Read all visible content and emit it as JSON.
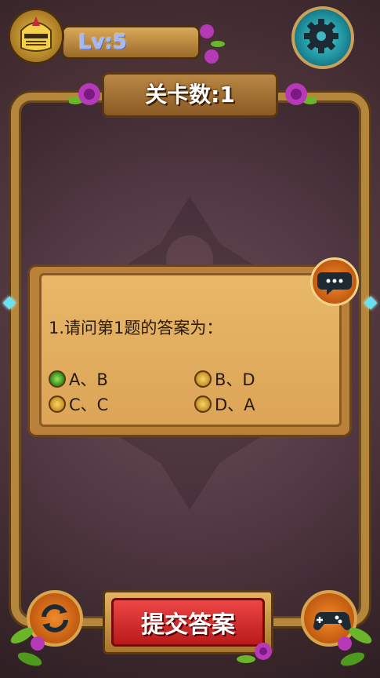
{
  "player": {
    "level_label": "Lv:5"
  },
  "header": {
    "level_title": "关卡数:1"
  },
  "question": {
    "text": "1.请问第1题的答案为：",
    "options": [
      {
        "label": "A、B",
        "selected": true
      },
      {
        "label": "B、D",
        "selected": false
      },
      {
        "label": "C、C",
        "selected": false
      },
      {
        "label": "D、A",
        "selected": false
      }
    ]
  },
  "buttons": {
    "submit_label": "提交答案"
  },
  "icons": {
    "avatar": "knight-helmet-icon",
    "settings": "gear-icon",
    "hint": "chat-bubble-icon",
    "refresh": "refresh-icon",
    "games": "gamepad-icon"
  },
  "colors": {
    "submit": "#d62222",
    "panel": "#e2ad5d",
    "frame": "#b4873c"
  }
}
